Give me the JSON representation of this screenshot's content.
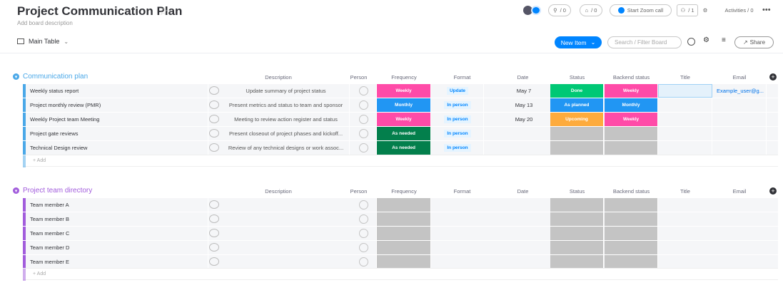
{
  "header": {
    "title": "Project Communication Plan",
    "description_placeholder": "Add board description",
    "main_table_label": "Main Table",
    "invite_count": "/ 0",
    "updates_count": "/ 0",
    "zoom_label": "Start Zoom call",
    "members_label": "/ 1",
    "activities_label": "Activities / 0",
    "new_item_label": "New Item",
    "search_placeholder": "Search / Filter Board",
    "share_label": "Share"
  },
  "colors": {
    "blue_group": "#4aa8e8",
    "purple_group": "#a25ddc",
    "pink": "#ff4ba8",
    "blue": "#2196f3",
    "green_dark": "#037f4c",
    "green": "#00c875",
    "orange": "#fdab3d",
    "grey": "#c4c4c4"
  },
  "columns": {
    "description": "Description",
    "person": "Person",
    "frequency": "Frequency",
    "format": "Format",
    "date": "Date",
    "status": "Status",
    "backend_status": "Backend status",
    "title": "Title",
    "email": "Email"
  },
  "group1": {
    "name": "Communication plan",
    "add_label": "+ Add",
    "rows": [
      {
        "name": "Weekly status report",
        "description": "Update summary of project status",
        "frequency": "Weekly",
        "format": "Update",
        "date": "May 7",
        "status": "Done",
        "backend": "Weekly",
        "email": "Example_user@g..."
      },
      {
        "name": "Project monthly review (PMR)",
        "description": "Present metrics and status to team and sponsor",
        "frequency": "Monthly",
        "format": "In person",
        "date": "May 13",
        "status": "As planned",
        "backend": "Monthly",
        "email": ""
      },
      {
        "name": "Weekly Project team Meeting",
        "description": "Meeting to review action register and status",
        "frequency": "Weekly",
        "format": "In person",
        "date": "May 20",
        "status": "Upcoming",
        "backend": "Weekly",
        "email": ""
      },
      {
        "name": "Project gate reviews",
        "description": "Present closeout of project phases and kickoff...",
        "frequency": "As needed",
        "format": "In person",
        "date": "",
        "status": "",
        "backend": "",
        "email": ""
      },
      {
        "name": "Technical Design review",
        "description": "Review of any technical designs or work assoc...",
        "frequency": "As needed",
        "format": "In person",
        "date": "",
        "status": "",
        "backend": "",
        "email": ""
      }
    ]
  },
  "group2": {
    "name": "Project team directory",
    "add_label": "+ Add",
    "rows": [
      {
        "name": "Team member A"
      },
      {
        "name": "Team member B"
      },
      {
        "name": "Team member C"
      },
      {
        "name": "Team member D"
      },
      {
        "name": "Team member E"
      }
    ]
  }
}
